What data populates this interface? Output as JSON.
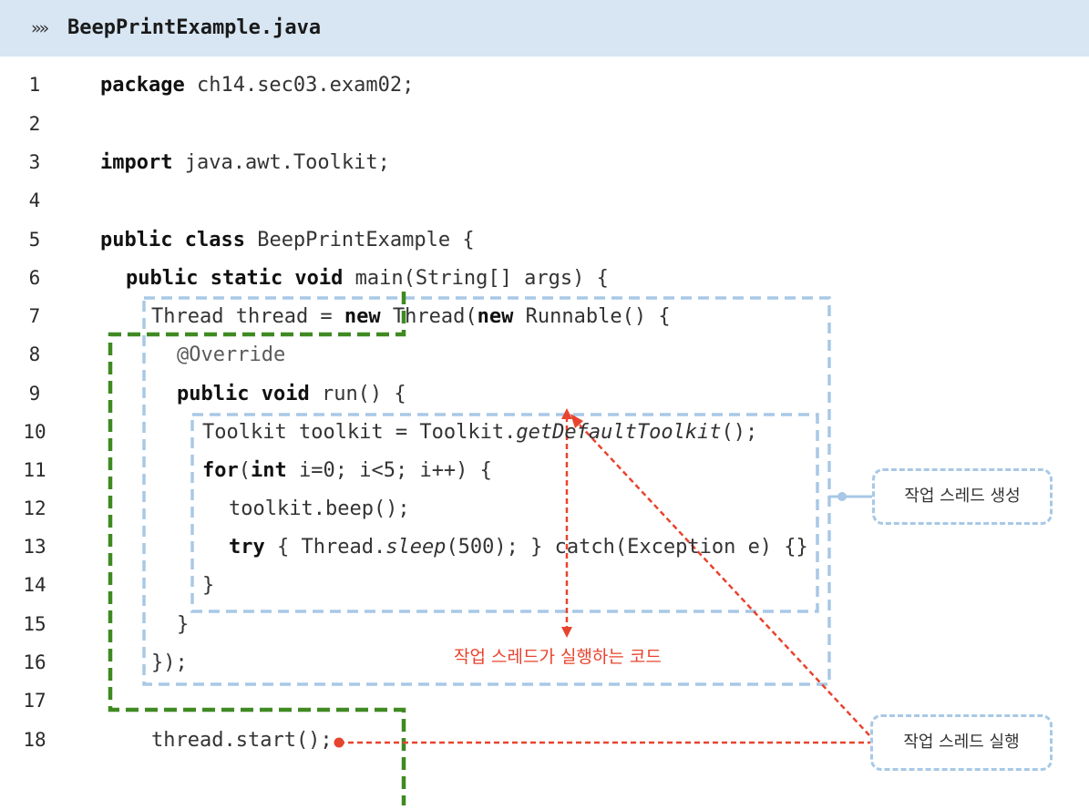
{
  "header": {
    "chevron": "»»",
    "filename": "BeepPrintExample.java"
  },
  "lines": [
    {
      "n": "1",
      "parts": [
        {
          "t": "package",
          "c": "kw"
        },
        {
          "t": " ch14.sec03.exam02;"
        }
      ]
    },
    {
      "n": "2",
      "parts": []
    },
    {
      "n": "3",
      "parts": [
        {
          "t": "import",
          "c": "kw"
        },
        {
          "t": " java.awt.Toolkit;"
        }
      ]
    },
    {
      "n": "4",
      "parts": []
    },
    {
      "n": "5",
      "parts": [
        {
          "t": "public class",
          "c": "kw"
        },
        {
          "t": " BeepPrintExample {"
        }
      ]
    },
    {
      "n": "6",
      "parts": [
        {
          "t": "public static void",
          "c": "kw"
        },
        {
          "t": " main(String[] args) {"
        }
      ]
    },
    {
      "n": "7",
      "parts": [
        {
          "t": "Thread thread = "
        },
        {
          "t": "new",
          "c": "kw"
        },
        {
          "t": " Thread("
        },
        {
          "t": "new",
          "c": "kw"
        },
        {
          "t": " Runnable() {"
        }
      ]
    },
    {
      "n": "8",
      "parts": [
        {
          "t": "@Override",
          "c": "ann"
        }
      ]
    },
    {
      "n": "9",
      "parts": [
        {
          "t": "public void",
          "c": "kw"
        },
        {
          "t": " run() {"
        }
      ]
    },
    {
      "n": "10",
      "parts": [
        {
          "t": "Toolkit toolkit = Toolkit."
        },
        {
          "t": "getDefaultToolkit",
          "c": "it"
        },
        {
          "t": "();"
        }
      ]
    },
    {
      "n": "11",
      "parts": [
        {
          "t": "for",
          "c": "kw"
        },
        {
          "t": "("
        },
        {
          "t": "int",
          "c": "kw"
        },
        {
          "t": " i=0; i<5; i++) {"
        }
      ]
    },
    {
      "n": "12",
      "parts": [
        {
          "t": "toolkit.beep();"
        }
      ]
    },
    {
      "n": "13",
      "parts": [
        {
          "t": "try",
          "c": "kw"
        },
        {
          "t": " { Thread."
        },
        {
          "t": "sleep",
          "c": "it"
        },
        {
          "t": "(500); } catch(Exception e) {}"
        }
      ]
    },
    {
      "n": "14",
      "parts": [
        {
          "t": "}"
        }
      ]
    },
    {
      "n": "15",
      "parts": [
        {
          "t": "}"
        }
      ]
    },
    {
      "n": "16",
      "parts": [
        {
          "t": "});"
        }
      ]
    },
    {
      "n": "17",
      "parts": []
    },
    {
      "n": "18",
      "parts": [
        {
          "t": "thread.start();"
        }
      ]
    }
  ],
  "annotations": {
    "create_thread": "작업 스레드 생성",
    "thread_runs_code": "작업 스레드가 실행하는 코드",
    "run_thread": "작업 스레드 실행"
  },
  "colors": {
    "header_bg": "#d8e6f3",
    "blue_dash": "#a8c8e6",
    "green_dash": "#3f8a22",
    "red": "#e8432e"
  }
}
